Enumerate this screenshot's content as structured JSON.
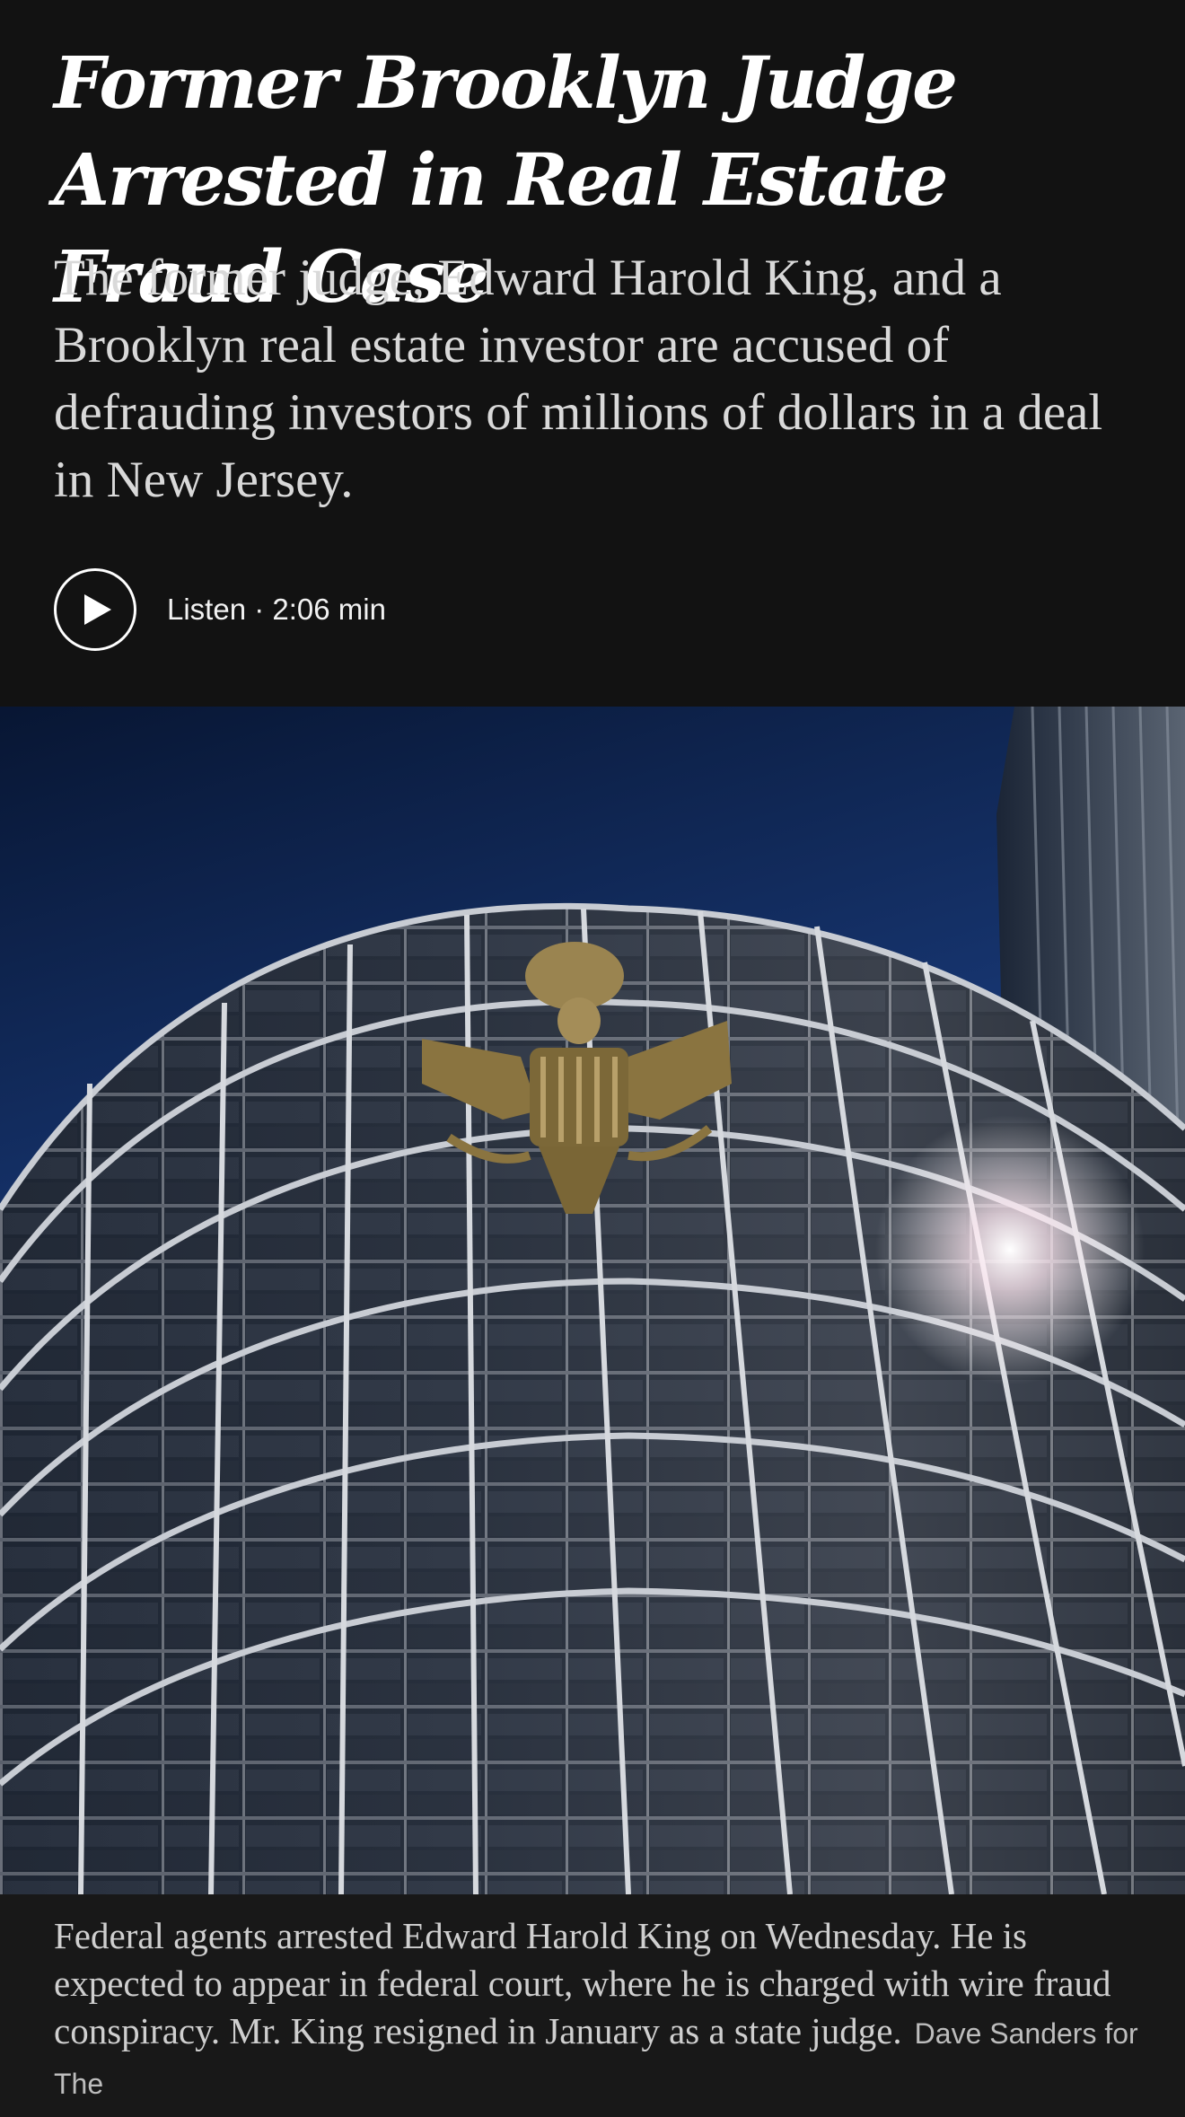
{
  "article": {
    "headline": "Former Brooklyn Judge Arrested in Real Estate Fraud Case",
    "summary": "The former judge, Edward Harold King, and a Brooklyn real estate investor are accused of defrauding investors of millions of dollars in a deal in New Jersey.",
    "listen": {
      "label": "Listen · 2:06 min",
      "icon": "play-icon"
    }
  },
  "photo": {
    "caption": "Federal agents arrested Edward Harold King on Wednesday. He is expected to appear in federal court, where he is charged with wire fraud conspiracy. Mr. King resigned in January as a state judge.",
    "credit": "Dave Sanders for The"
  },
  "colors": {
    "background": "#121212",
    "text": "#ffffff",
    "subtext": "#d9d9d9",
    "sky": "#0b1a3a",
    "eagle": "#8a7440"
  }
}
